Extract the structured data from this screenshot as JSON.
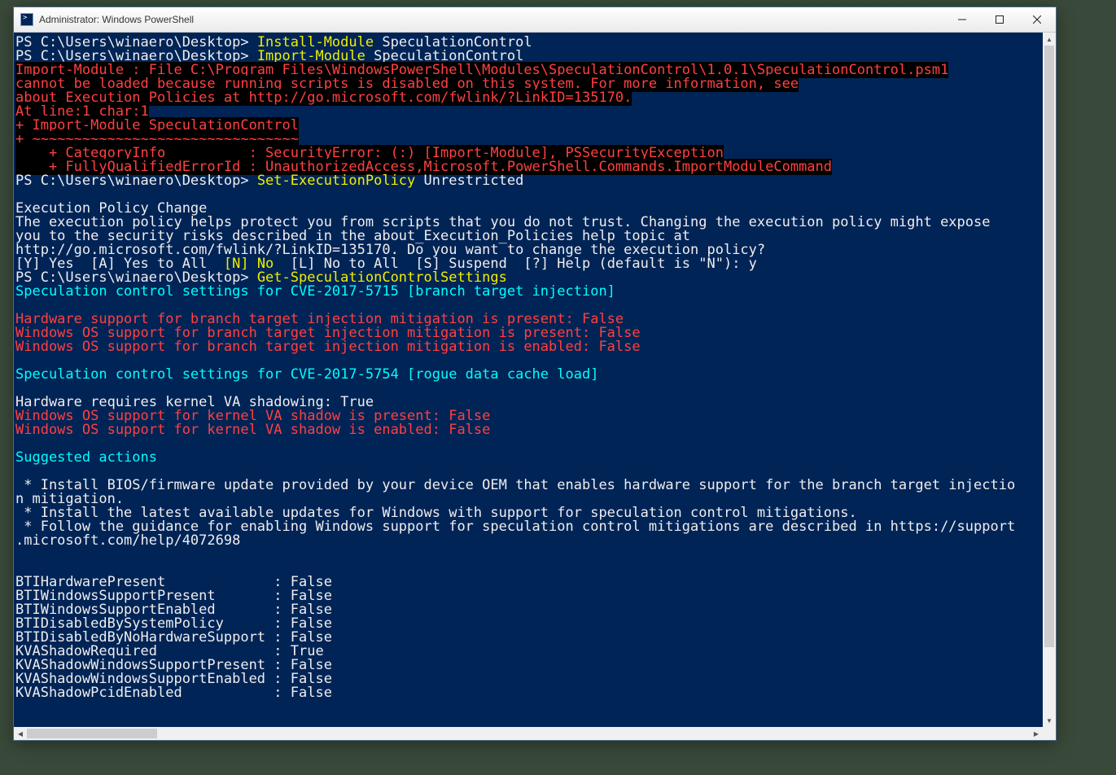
{
  "window": {
    "title": "Administrator: Windows PowerShell"
  },
  "term": {
    "lines": [
      {
        "runs": [
          {
            "cls": "white",
            "t": "PS C:\\Users\\winaero\\Desktop> "
          },
          {
            "cls": "yellow",
            "t": "Install-Module "
          },
          {
            "cls": "white",
            "t": "SpeculationControl"
          }
        ]
      },
      {
        "runs": [
          {
            "cls": "white",
            "t": "PS C:\\Users\\winaero\\Desktop> "
          },
          {
            "cls": "yellow",
            "t": "Import-Module "
          },
          {
            "cls": "white",
            "t": "SpeculationControl"
          }
        ]
      },
      {
        "runs": [
          {
            "cls": "red",
            "t": "Import-Module : File C:\\Program Files\\WindowsPowerShell\\Modules\\SpeculationControl\\1.0.1\\SpeculationControl.psm1"
          }
        ]
      },
      {
        "runs": [
          {
            "cls": "red",
            "t": "cannot be loaded because running scripts is disabled on this system. For more information, see"
          }
        ]
      },
      {
        "runs": [
          {
            "cls": "red",
            "t": "about_Execution_Policies at http://go.microsoft.com/fwlink/?LinkID=135170."
          }
        ]
      },
      {
        "runs": [
          {
            "cls": "red",
            "t": "At line:1 char:1"
          }
        ]
      },
      {
        "runs": [
          {
            "cls": "red",
            "t": "+ Import-Module SpeculationControl"
          }
        ]
      },
      {
        "runs": [
          {
            "cls": "red",
            "t": "+ ~~~~~~~~~~~~~~~~~~~~~~~~~~~~~~~~"
          }
        ]
      },
      {
        "runs": [
          {
            "cls": "red",
            "t": "    + CategoryInfo          : SecurityError: (:) [Import-Module], PSSecurityException"
          }
        ]
      },
      {
        "runs": [
          {
            "cls": "red",
            "t": "    + FullyQualifiedErrorId : UnauthorizedAccess,Microsoft.PowerShell.Commands.ImportModuleCommand"
          }
        ]
      },
      {
        "runs": [
          {
            "cls": "white",
            "t": "PS C:\\Users\\winaero\\Desktop> "
          },
          {
            "cls": "yellow",
            "t": "Set-ExecutionPolicy "
          },
          {
            "cls": "white",
            "t": "Unrestricted"
          }
        ]
      },
      {
        "runs": [
          {
            "cls": "white",
            "t": "Execution Policy Change"
          }
        ],
        "topgap": 1
      },
      {
        "runs": [
          {
            "cls": "white",
            "t": "The execution policy helps protect you from scripts that you do not trust. Changing the execution policy might expose"
          }
        ]
      },
      {
        "runs": [
          {
            "cls": "white",
            "t": "you to the security risks described in the about_Execution_Policies help topic at"
          }
        ]
      },
      {
        "runs": [
          {
            "cls": "white",
            "t": "http://go.microsoft.com/fwlink/?LinkID=135170. Do you want to change the execution policy?"
          }
        ]
      },
      {
        "runs": [
          {
            "cls": "white",
            "t": "[Y] Yes  [A] Yes to All  "
          },
          {
            "cls": "yellow",
            "t": "[N] No"
          },
          {
            "cls": "white",
            "t": "  [L] No to All  [S] Suspend  [?] Help (default is \"N\"): y"
          }
        ]
      },
      {
        "runs": [
          {
            "cls": "white",
            "t": "PS C:\\Users\\winaero\\Desktop> "
          },
          {
            "cls": "yellow",
            "t": "Get-SpeculationControlSettings"
          }
        ]
      },
      {
        "runs": [
          {
            "cls": "cyan",
            "t": "Speculation control settings for CVE-2017-5715 [branch target injection]"
          }
        ]
      },
      {
        "runs": [
          {
            "cls": "red-nobg",
            "t": "Hardware support for branch target injection mitigation is present: False"
          }
        ],
        "topgap": 1
      },
      {
        "runs": [
          {
            "cls": "red-nobg",
            "t": "Windows OS support for branch target injection mitigation is present: False"
          }
        ]
      },
      {
        "runs": [
          {
            "cls": "red-nobg",
            "t": "Windows OS support for branch target injection mitigation is enabled: False"
          }
        ]
      },
      {
        "runs": [
          {
            "cls": "cyan",
            "t": "Speculation control settings for CVE-2017-5754 [rogue data cache load]"
          }
        ],
        "topgap": 1
      },
      {
        "runs": [
          {
            "cls": "white",
            "t": "Hardware requires kernel VA shadowing: True"
          }
        ],
        "topgap": 1
      },
      {
        "runs": [
          {
            "cls": "red-nobg",
            "t": "Windows OS support for kernel VA shadow is present: False"
          }
        ]
      },
      {
        "runs": [
          {
            "cls": "red-nobg",
            "t": "Windows OS support for kernel VA shadow is enabled: False"
          }
        ]
      },
      {
        "runs": [
          {
            "cls": "cyan",
            "t": "Suggested actions"
          }
        ],
        "topgap": 1
      },
      {
        "runs": [
          {
            "cls": "white",
            "t": " * Install BIOS/firmware update provided by your device OEM that enables hardware support for the branch target injectio"
          }
        ],
        "topgap": 1
      },
      {
        "runs": [
          {
            "cls": "white",
            "t": "n mitigation."
          }
        ]
      },
      {
        "runs": [
          {
            "cls": "white",
            "t": " * Install the latest available updates for Windows with support for speculation control mitigations."
          }
        ]
      },
      {
        "runs": [
          {
            "cls": "white",
            "t": " * Follow the guidance for enabling Windows support for speculation control mitigations are described in https://support"
          }
        ]
      },
      {
        "runs": [
          {
            "cls": "white",
            "t": ".microsoft.com/help/4072698"
          }
        ]
      },
      {
        "runs": [
          {
            "cls": "white",
            "t": "BTIHardwarePresent             : False"
          }
        ],
        "topgap": 2
      },
      {
        "runs": [
          {
            "cls": "white",
            "t": "BTIWindowsSupportPresent       : False"
          }
        ]
      },
      {
        "runs": [
          {
            "cls": "white",
            "t": "BTIWindowsSupportEnabled       : False"
          }
        ]
      },
      {
        "runs": [
          {
            "cls": "white",
            "t": "BTIDisabledBySystemPolicy      : False"
          }
        ]
      },
      {
        "runs": [
          {
            "cls": "white",
            "t": "BTIDisabledByNoHardwareSupport : False"
          }
        ]
      },
      {
        "runs": [
          {
            "cls": "white",
            "t": "KVAShadowRequired              : True"
          }
        ]
      },
      {
        "runs": [
          {
            "cls": "white",
            "t": "KVAShadowWindowsSupportPresent : False"
          }
        ]
      },
      {
        "runs": [
          {
            "cls": "white",
            "t": "KVAShadowWindowsSupportEnabled : False"
          }
        ]
      },
      {
        "runs": [
          {
            "cls": "white",
            "t": "KVAShadowPcidEnabled           : False"
          }
        ]
      }
    ]
  },
  "scroll": {
    "up": "▲",
    "down": "▼",
    "left": "◀",
    "right": "▶"
  }
}
